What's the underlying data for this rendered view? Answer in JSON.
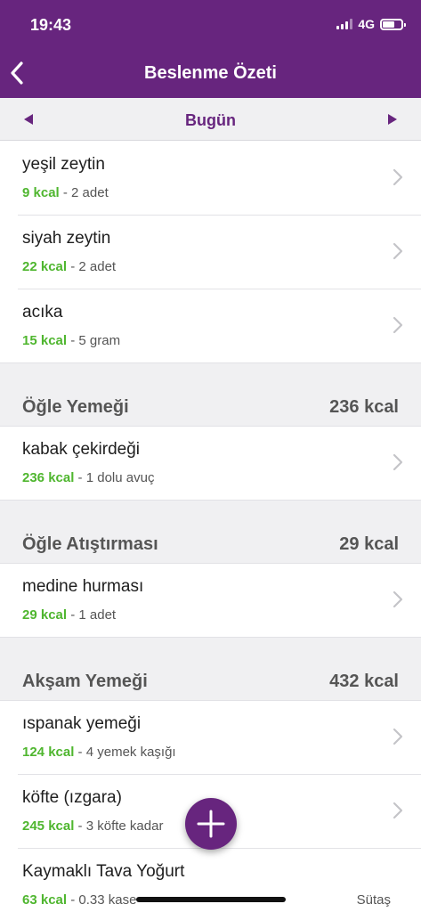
{
  "status_bar": {
    "time": "19:43",
    "network": "4G"
  },
  "nav": {
    "title": "Beslenme Özeti"
  },
  "date_bar": {
    "label": "Bugün"
  },
  "colors": {
    "primary": "#67257e",
    "kcal_green": "#4fb62f",
    "section_bg": "#f0f0f2"
  },
  "icons": {
    "back": "chevron-left-icon",
    "prev": "triangle-left-icon",
    "next": "triangle-right-icon",
    "row": "chevron-right-icon",
    "fab": "plus-icon"
  },
  "top_items": [
    {
      "name": "yeşil zeytin",
      "kcal": "9 kcal",
      "portion": " - 2 adet"
    },
    {
      "name": "siyah zeytin",
      "kcal": "22 kcal",
      "portion": " - 2 adet"
    },
    {
      "name": "acıka",
      "kcal": "15 kcal",
      "portion": " - 5 gram"
    }
  ],
  "sections": [
    {
      "title": "Öğle Yemeği",
      "total": "236 kcal",
      "items": [
        {
          "name": "kabak çekirdeği",
          "kcal": "236 kcal",
          "portion": " - 1 dolu avuç"
        }
      ]
    },
    {
      "title": "Öğle Atıştırması",
      "total": "29 kcal",
      "items": [
        {
          "name": "medine hurması",
          "kcal": "29 kcal",
          "portion": " - 1 adet"
        }
      ]
    },
    {
      "title": "Akşam Yemeği",
      "total": "432 kcal",
      "items": [
        {
          "name": "ıspanak yemeği",
          "kcal": "124 kcal",
          "portion": " - 4 yemek kaşığı"
        },
        {
          "name": "köfte (ızgara)",
          "kcal": "245 kcal",
          "portion": " - 3 köfte kadar"
        },
        {
          "name": "Kaymaklı Tava Yoğurt",
          "kcal": "63 kcal",
          "portion": " - 0.33 kase",
          "brand": "Sütaş"
        }
      ]
    }
  ]
}
